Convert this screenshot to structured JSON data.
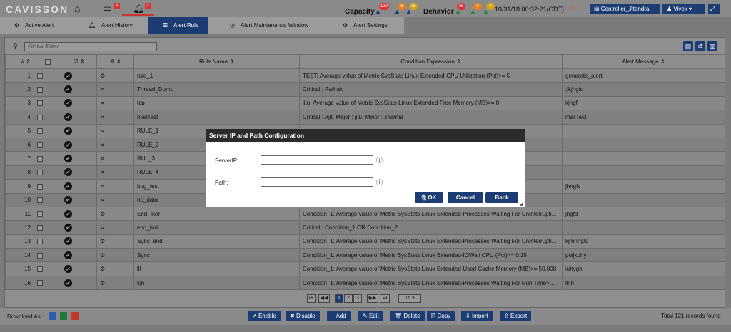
{
  "header": {
    "logo": "CAVISSON",
    "capacity_label": "Capacity",
    "capacity_badges": [
      "120",
      "8",
      "11"
    ],
    "behavior_label": "Behavior",
    "behavior_badges": [
      "36",
      "0",
      "0"
    ],
    "datetime": "10/31/18 00:32:21(CDT)",
    "controller": "Controller_Jitendra",
    "user": "Vivek"
  },
  "tabs": [
    {
      "label": "Active Alert",
      "icon": "gear-icon"
    },
    {
      "label": "Alert History",
      "icon": "bell-icon"
    },
    {
      "label": "Alert Rule",
      "icon": "list-icon",
      "active": true
    },
    {
      "label": "Alert Maintenance Window",
      "icon": "clock-icon"
    },
    {
      "label": "Alert Settings",
      "icon": "settings-icon"
    }
  ],
  "filter": {
    "placeholder": "Global Filter"
  },
  "table": {
    "headers": [
      "#",
      "",
      "",
      "",
      "Rule Name",
      "Condition Expression",
      "Alert Message"
    ],
    "rows": [
      {
        "n": "1",
        "name": "rule_1",
        "expr": "TEST: Average value of Metric SysStats Linux Extended-CPU Utilization (Pct)>= 5",
        "msg": "generate_alert"
      },
      {
        "n": "2",
        "name": "Thread_Dump",
        "expr": "Critical : Pathak",
        "msg": ";lkjhgfd"
      },
      {
        "n": "3",
        "name": "tcp",
        "expr": "jitu: Average value of Metric SysStats Linux Extended-Free Memory (MB)>= 0",
        "msg": "kjhgf"
      },
      {
        "n": "4",
        "name": "mailTest",
        "expr": "Critical : Ajit, Major : jitu, Minor : sharma",
        "msg": "mailTest"
      },
      {
        "n": "5",
        "name": "RULE_1",
        "expr": "",
        "msg": ""
      },
      {
        "n": "6",
        "name": "RULE_2",
        "expr": "",
        "msg": ""
      },
      {
        "n": "7",
        "name": "RUL_3",
        "expr": "",
        "msg": ""
      },
      {
        "n": "8",
        "name": "RULE_4",
        "expr": "",
        "msg": ""
      },
      {
        "n": "9",
        "name": "bug_test",
        "expr": "",
        "msg": "jhngfv"
      },
      {
        "n": "10",
        "name": "no_data",
        "expr": "",
        "msg": ""
      },
      {
        "n": "11",
        "name": "End_Tier",
        "expr": "Condition_1: Average value of Metric SysStats Linux Extended-Processes Waiting For UnInterrupti...",
        "msg": "jhgfd"
      },
      {
        "n": "12",
        "name": "end_Indi",
        "expr": "Critical : Condition_1 OR Condition_2",
        "msg": ""
      },
      {
        "n": "13",
        "name": "Sync_end",
        "expr": "Condition_1: Average value of Metric SysStats Linux Extended-Processes Waiting For UnInterrupti...",
        "msg": "kjmhngfd"
      },
      {
        "n": "14",
        "name": "Sync",
        "expr": "Condition_1: Average value of Metric SysStats Linux Extended-IOWait CPU (Pct)>= 0.15",
        "msg": "poijkuhy"
      },
      {
        "n": "15",
        "name": "lll",
        "expr": "Condition_1: Average value of Metric SysStats Linux Extended-Used Cache Memory (MB)>= 50,000",
        "msg": "iuhygh"
      },
      {
        "n": "16",
        "name": "kjh",
        "expr": "Condition_1: Average value of Metric SysStats Linux Extended-Processes Waiting For Run Time>...",
        "msg": "lkjh"
      }
    ]
  },
  "pager": {
    "pages": [
      "1",
      "2",
      "3"
    ],
    "page_size": "16"
  },
  "footer": {
    "download_label": "Download As :",
    "buttons": [
      "Enable",
      "Disable",
      "Add",
      "Edit",
      "Delete",
      "Copy",
      "Import",
      "Export"
    ],
    "total": "Total 121 records found"
  },
  "dialog": {
    "title": "Server IP and Path Configuration",
    "server_label": "ServerIP:",
    "path_label": "Path:",
    "ok": "OK",
    "cancel": "Cancel",
    "back": "Back"
  }
}
